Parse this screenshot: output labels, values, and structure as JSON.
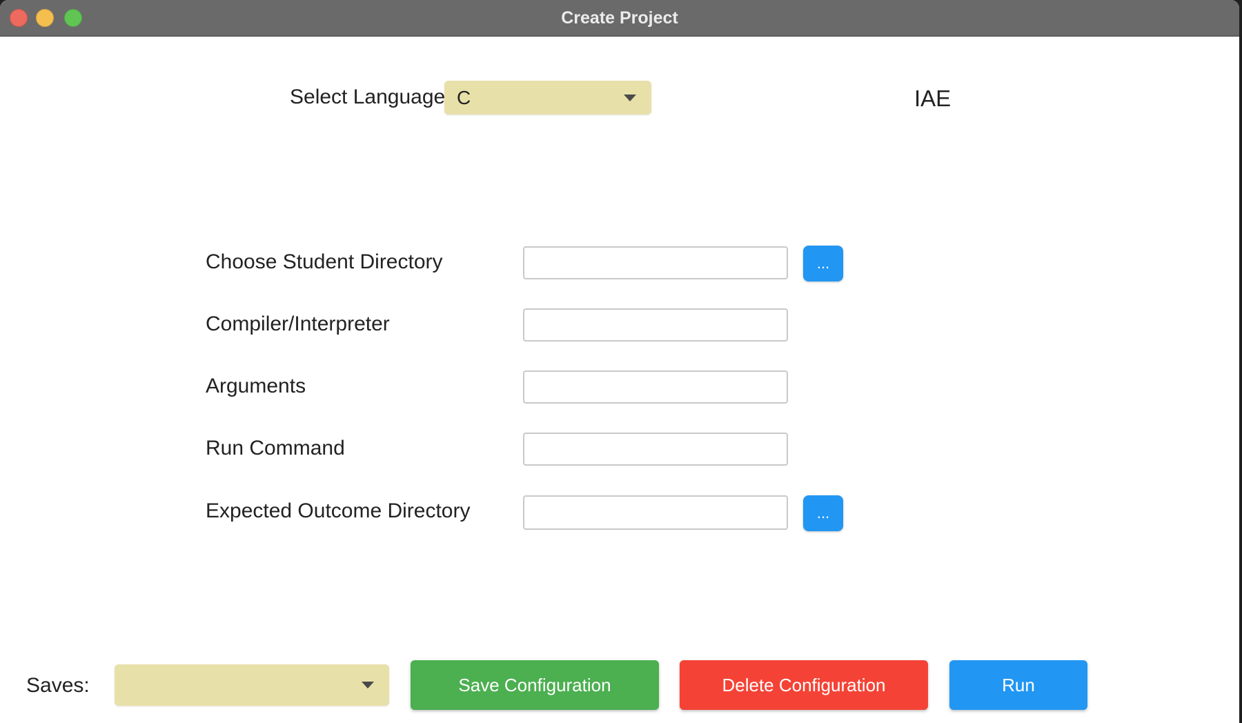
{
  "window": {
    "title": "Create Project"
  },
  "language": {
    "label": "Select Language",
    "selected": "C"
  },
  "app_name": "IAE",
  "form": {
    "student_dir": {
      "label": "Choose Student Directory",
      "value": "",
      "browse_label": "..."
    },
    "compiler": {
      "label": "Compiler/Interpreter",
      "value": ""
    },
    "arguments": {
      "label": "Arguments",
      "value": ""
    },
    "run_command": {
      "label": "Run Command",
      "value": ""
    },
    "expected_dir": {
      "label": "Expected Outcome Directory",
      "value": "",
      "browse_label": "..."
    }
  },
  "footer": {
    "saves_label": "Saves:",
    "saves_selected": "",
    "save_button": "Save Configuration",
    "delete_button": "Delete Configuration",
    "run_button": "Run"
  },
  "colors": {
    "combo_bg": "#e8e0a9",
    "save": "#4caf50",
    "delete": "#f44336",
    "run": "#2196f3"
  }
}
